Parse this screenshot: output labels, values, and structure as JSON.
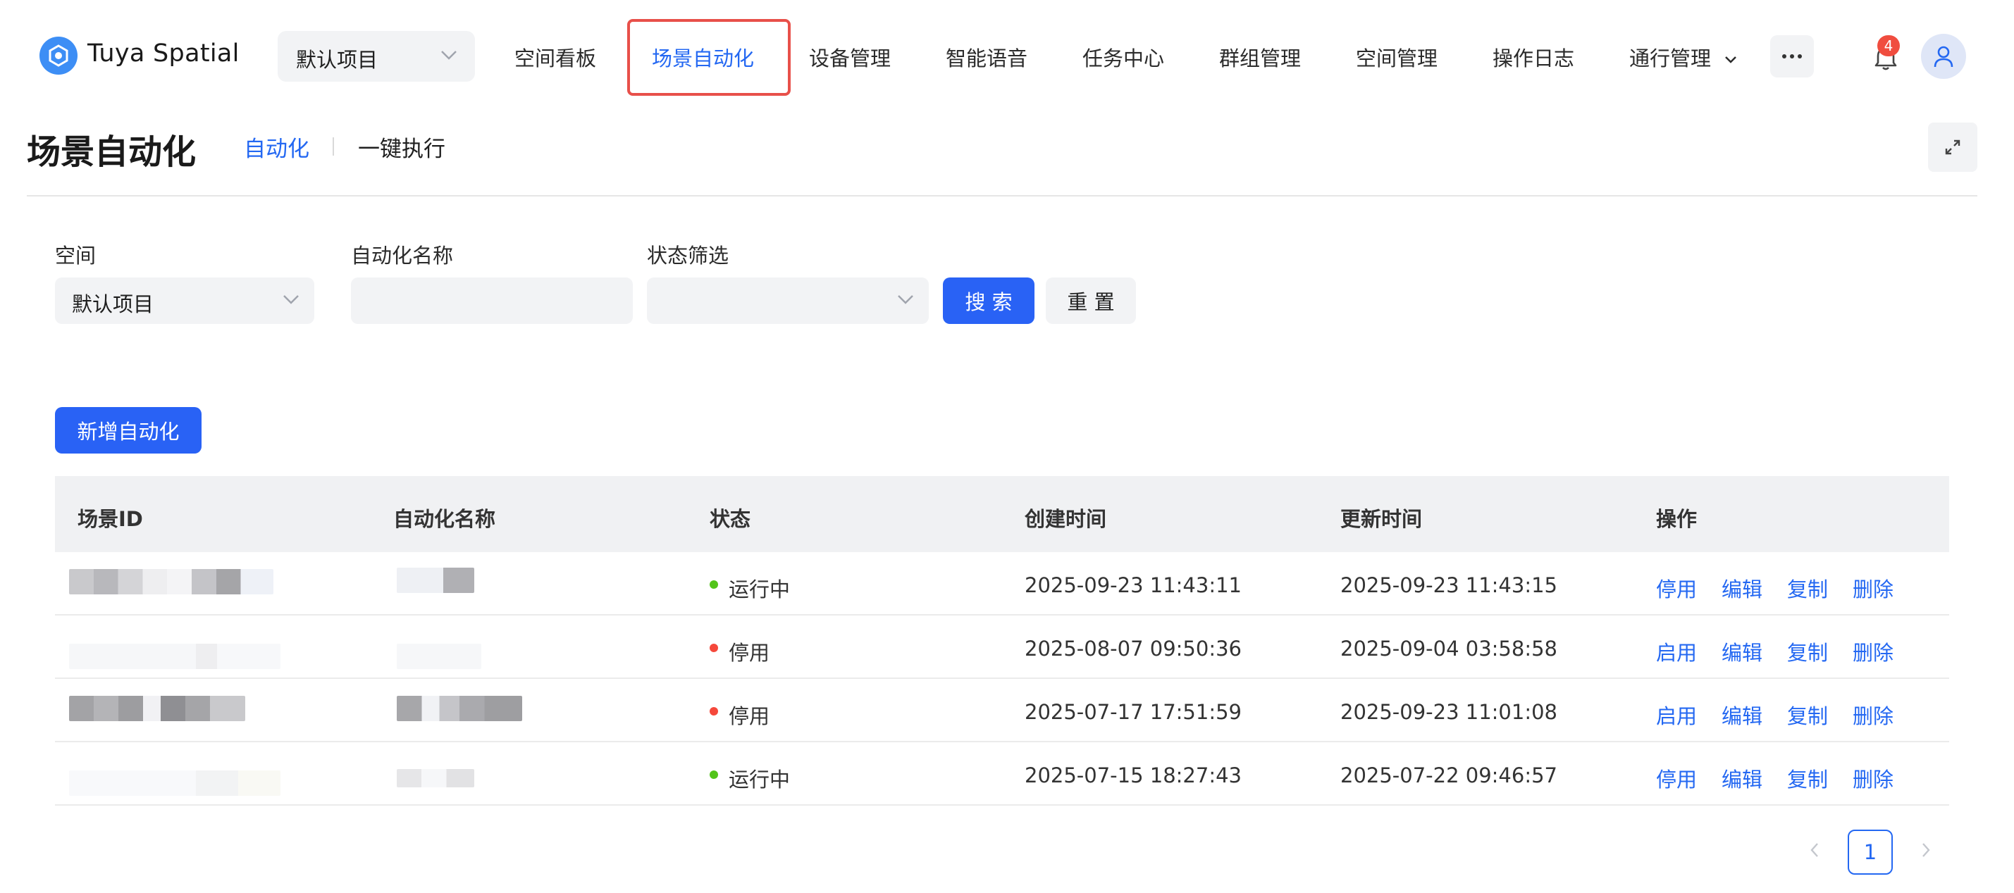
{
  "brand": {
    "name": "Tuya Spatial",
    "accent": "#2468f2"
  },
  "project_select": {
    "value": "默认项目"
  },
  "nav": {
    "items": [
      {
        "label": "空间看板"
      },
      {
        "label": "场景自动化",
        "active": true
      },
      {
        "label": "设备管理"
      },
      {
        "label": "智能语音"
      },
      {
        "label": "任务中心"
      },
      {
        "label": "群组管理"
      },
      {
        "label": "空间管理"
      },
      {
        "label": "操作日志"
      },
      {
        "label": "通行管理"
      }
    ],
    "more_icon": "ellipsis-icon",
    "notification_count": "4"
  },
  "page": {
    "title": "场景自动化",
    "tabs": [
      {
        "label": "自动化",
        "active": true
      },
      {
        "label": "一键执行"
      }
    ]
  },
  "filters": {
    "space": {
      "label": "空间",
      "value": "默认项目"
    },
    "name": {
      "label": "自动化名称",
      "value": ""
    },
    "status": {
      "label": "状态筛选",
      "value": ""
    },
    "search_label": "搜 索",
    "reset_label": "重 置"
  },
  "add_button_label": "新增自动化",
  "table": {
    "columns": [
      "场景ID",
      "自动化名称",
      "状态",
      "创建时间",
      "更新时间",
      "操作"
    ],
    "rows": [
      {
        "status": "运行中",
        "status_color": "#52c41a",
        "created": "2025-09-23 11:43:11",
        "updated": "2025-09-23 11:43:15",
        "toggle_action": "停用",
        "edit": "编辑",
        "copy": "复制",
        "delete": "删除"
      },
      {
        "status": "停用",
        "status_color": "#f5483b",
        "created": "2025-08-07 09:50:36",
        "updated": "2025-09-04 03:58:58",
        "toggle_action": "启用",
        "edit": "编辑",
        "copy": "复制",
        "delete": "删除"
      },
      {
        "status": "停用",
        "status_color": "#f5483b",
        "created": "2025-07-17 17:51:59",
        "updated": "2025-09-23 11:01:08",
        "toggle_action": "启用",
        "edit": "编辑",
        "copy": "复制",
        "delete": "删除"
      },
      {
        "status": "运行中",
        "status_color": "#52c41a",
        "created": "2025-07-15 18:27:43",
        "updated": "2025-07-22 09:46:57",
        "toggle_action": "停用",
        "edit": "编辑",
        "copy": "复制",
        "delete": "删除"
      }
    ]
  },
  "pagination": {
    "current": "1"
  }
}
